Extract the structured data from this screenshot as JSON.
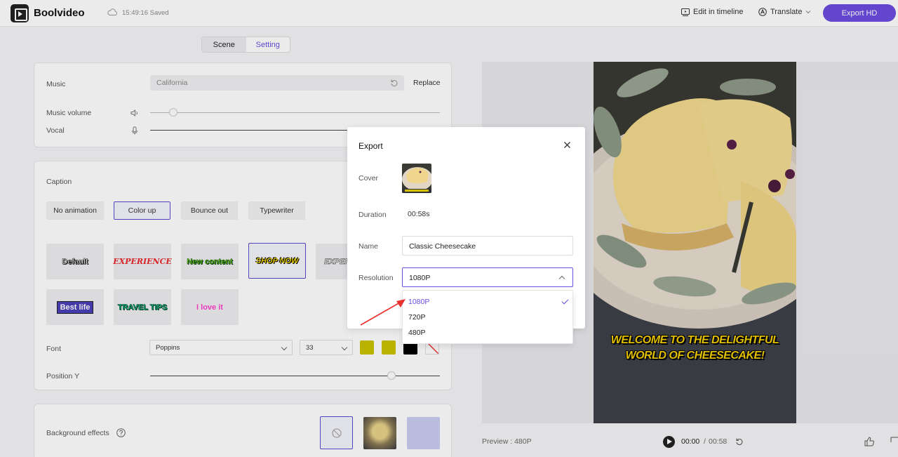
{
  "header": {
    "brand": "Boolvideo",
    "saved_time": "15:49:16",
    "saved_status": "Saved",
    "edit_timeline": "Edit in timeline",
    "translate": "Translate",
    "export_hd": "Export HD"
  },
  "tabs": {
    "scene": "Scene",
    "setting": "Setting"
  },
  "music": {
    "label": "Music",
    "value": "California",
    "replace": "Replace",
    "volume_label": "Music volume",
    "vocal_label": "Vocal"
  },
  "caption": {
    "label": "Caption",
    "animations": [
      "No animation",
      "Color up",
      "Bounce out",
      "Typewriter"
    ],
    "styles": [
      "Default",
      "EXPERIENCE",
      "New content",
      "SHOP NOW",
      "EXPERI",
      "Best life",
      "TRAVEL TIPS",
      "I love it"
    ],
    "font_label": "Font",
    "font_value": "Poppins",
    "size_value": "33",
    "position_label": "Position Y",
    "colors": [
      "#c9c200",
      "#c9c200",
      "#000000"
    ]
  },
  "background": {
    "label": "Background effects"
  },
  "preview": {
    "caption_text": "WELCOME TO THE DELIGHTFUL WORLD OF CHEESECAKE!",
    "label": "Preview : 480P",
    "time_current": "00:00",
    "time_sep": "/",
    "time_total": "00:58"
  },
  "modal": {
    "title": "Export",
    "cover_label": "Cover",
    "duration_label": "Duration",
    "duration_value": "00:58s",
    "name_label": "Name",
    "name_value": "Classic Cheesecake",
    "resolution_label": "Resolution",
    "resolution_value": "1080P",
    "options": [
      "1080P",
      "720P",
      "480P"
    ]
  },
  "colors": {
    "accent": "#6b4de0",
    "arrow": "#e8322e"
  }
}
